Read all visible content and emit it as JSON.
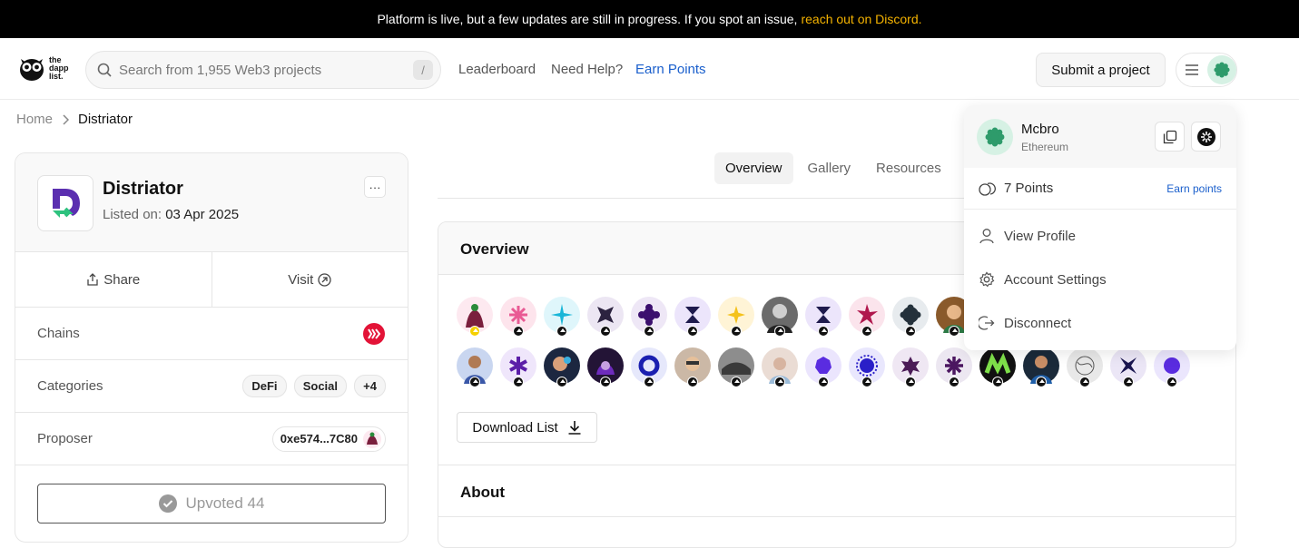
{
  "banner": {
    "text": "Platform is live, but a few updates are still in progress. If you spot an issue,",
    "link": "reach out on Discord."
  },
  "logo": {
    "text": "the dapp list."
  },
  "search": {
    "placeholder": "Search from 1,955 Web3 projects",
    "shortcut": "/"
  },
  "nav": {
    "leaderboard": "Leaderboard",
    "help": "Need Help?",
    "earn": "Earn Points",
    "submit": "Submit a project"
  },
  "breadcrumb": {
    "home": "Home",
    "current": "Distriator"
  },
  "project": {
    "name": "Distriator",
    "listed_label": "Listed on:",
    "listed_date": "03 Apr 2025",
    "more": "···",
    "share": "Share",
    "visit": "Visit",
    "chains_label": "Chains",
    "categories_label": "Categories",
    "categories": [
      "DeFi",
      "Social",
      "+4"
    ],
    "proposer_label": "Proposer",
    "proposer": "0xe574...7C80",
    "upvote": "Upvoted 44"
  },
  "tabs": [
    "Overview",
    "Gallery",
    "Resources"
  ],
  "overview": {
    "title": "Overview",
    "download": "Download List",
    "about": "About"
  },
  "dropdown": {
    "name": "Mcbro",
    "network": "Ethereum",
    "points": "7 Points",
    "earn": "Earn points",
    "items": [
      "View Profile",
      "Account Settings",
      "Disconnect"
    ]
  },
  "colors": {
    "accent": "#1a5fcc",
    "banner_link": "#f5b301",
    "hive_red": "#e31337"
  }
}
